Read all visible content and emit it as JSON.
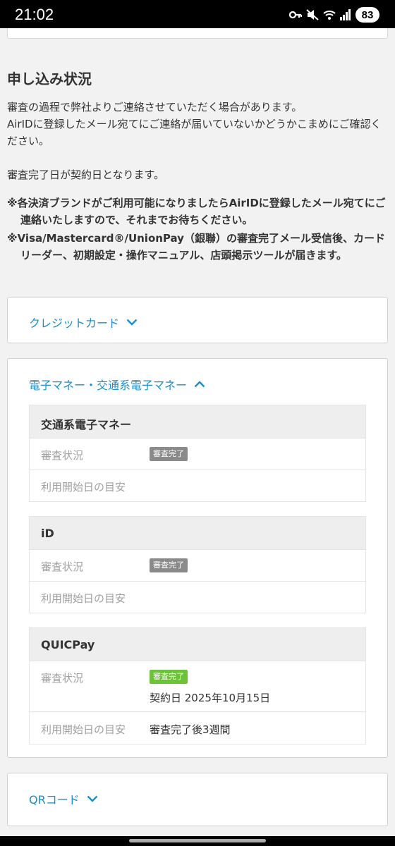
{
  "status_bar": {
    "time": "21:02",
    "battery": "83",
    "icons": [
      "key-icon",
      "mute-icon",
      "wifi-icon",
      "signal-icon",
      "battery-icon"
    ]
  },
  "page": {
    "title": "申し込み状況",
    "intro": [
      "審査の過程で弊社よりご連絡させていただく場合があります。",
      "AirIDに登録したメール宛てにご連絡が届いていないかどうかこまめにご確認ください。",
      "審査完了日が契約日となります。"
    ],
    "notes": [
      "※各決済ブランドがご利用可能になりましたらAirIDに登録したメール宛てにご連絡いたしますので、それまでお待ちください。",
      "※Visa/Mastercard®/UnionPay（銀聯）の審査完了メール受信後、カードリーダー、初期設定・操作マニュアル、店頭掲示ツールが届きます。"
    ]
  },
  "accordions": {
    "credit": {
      "label": "クレジットカード",
      "expanded": false
    },
    "emoney": {
      "label": "電子マネー・交通系電子マネー",
      "expanded": true,
      "blocks": [
        {
          "title": "交通系電子マネー",
          "status_label": "審査状況",
          "status_badge": "審査完了",
          "status_color": "#8a8a8a",
          "contract": "",
          "start_label": "利用開始日の目安",
          "start_value": ""
        },
        {
          "title": "iD",
          "status_label": "審査状況",
          "status_badge": "審査完了",
          "status_color": "#8a8a8a",
          "contract": "",
          "start_label": "利用開始日の目安",
          "start_value": ""
        },
        {
          "title": "QUICPay",
          "status_label": "審査状況",
          "status_badge": "審査完了",
          "status_color": "#6cc23a",
          "contract": "契約日 2025年10月15日",
          "start_label": "利用開始日の目安",
          "start_value": "審査完了後3週間"
        }
      ]
    },
    "qr": {
      "label": "QRコード",
      "expanded": false
    }
  },
  "colors": {
    "accent": "#1a8fc9",
    "badge_gray": "#8a8a8a",
    "badge_green": "#6cc23a"
  }
}
